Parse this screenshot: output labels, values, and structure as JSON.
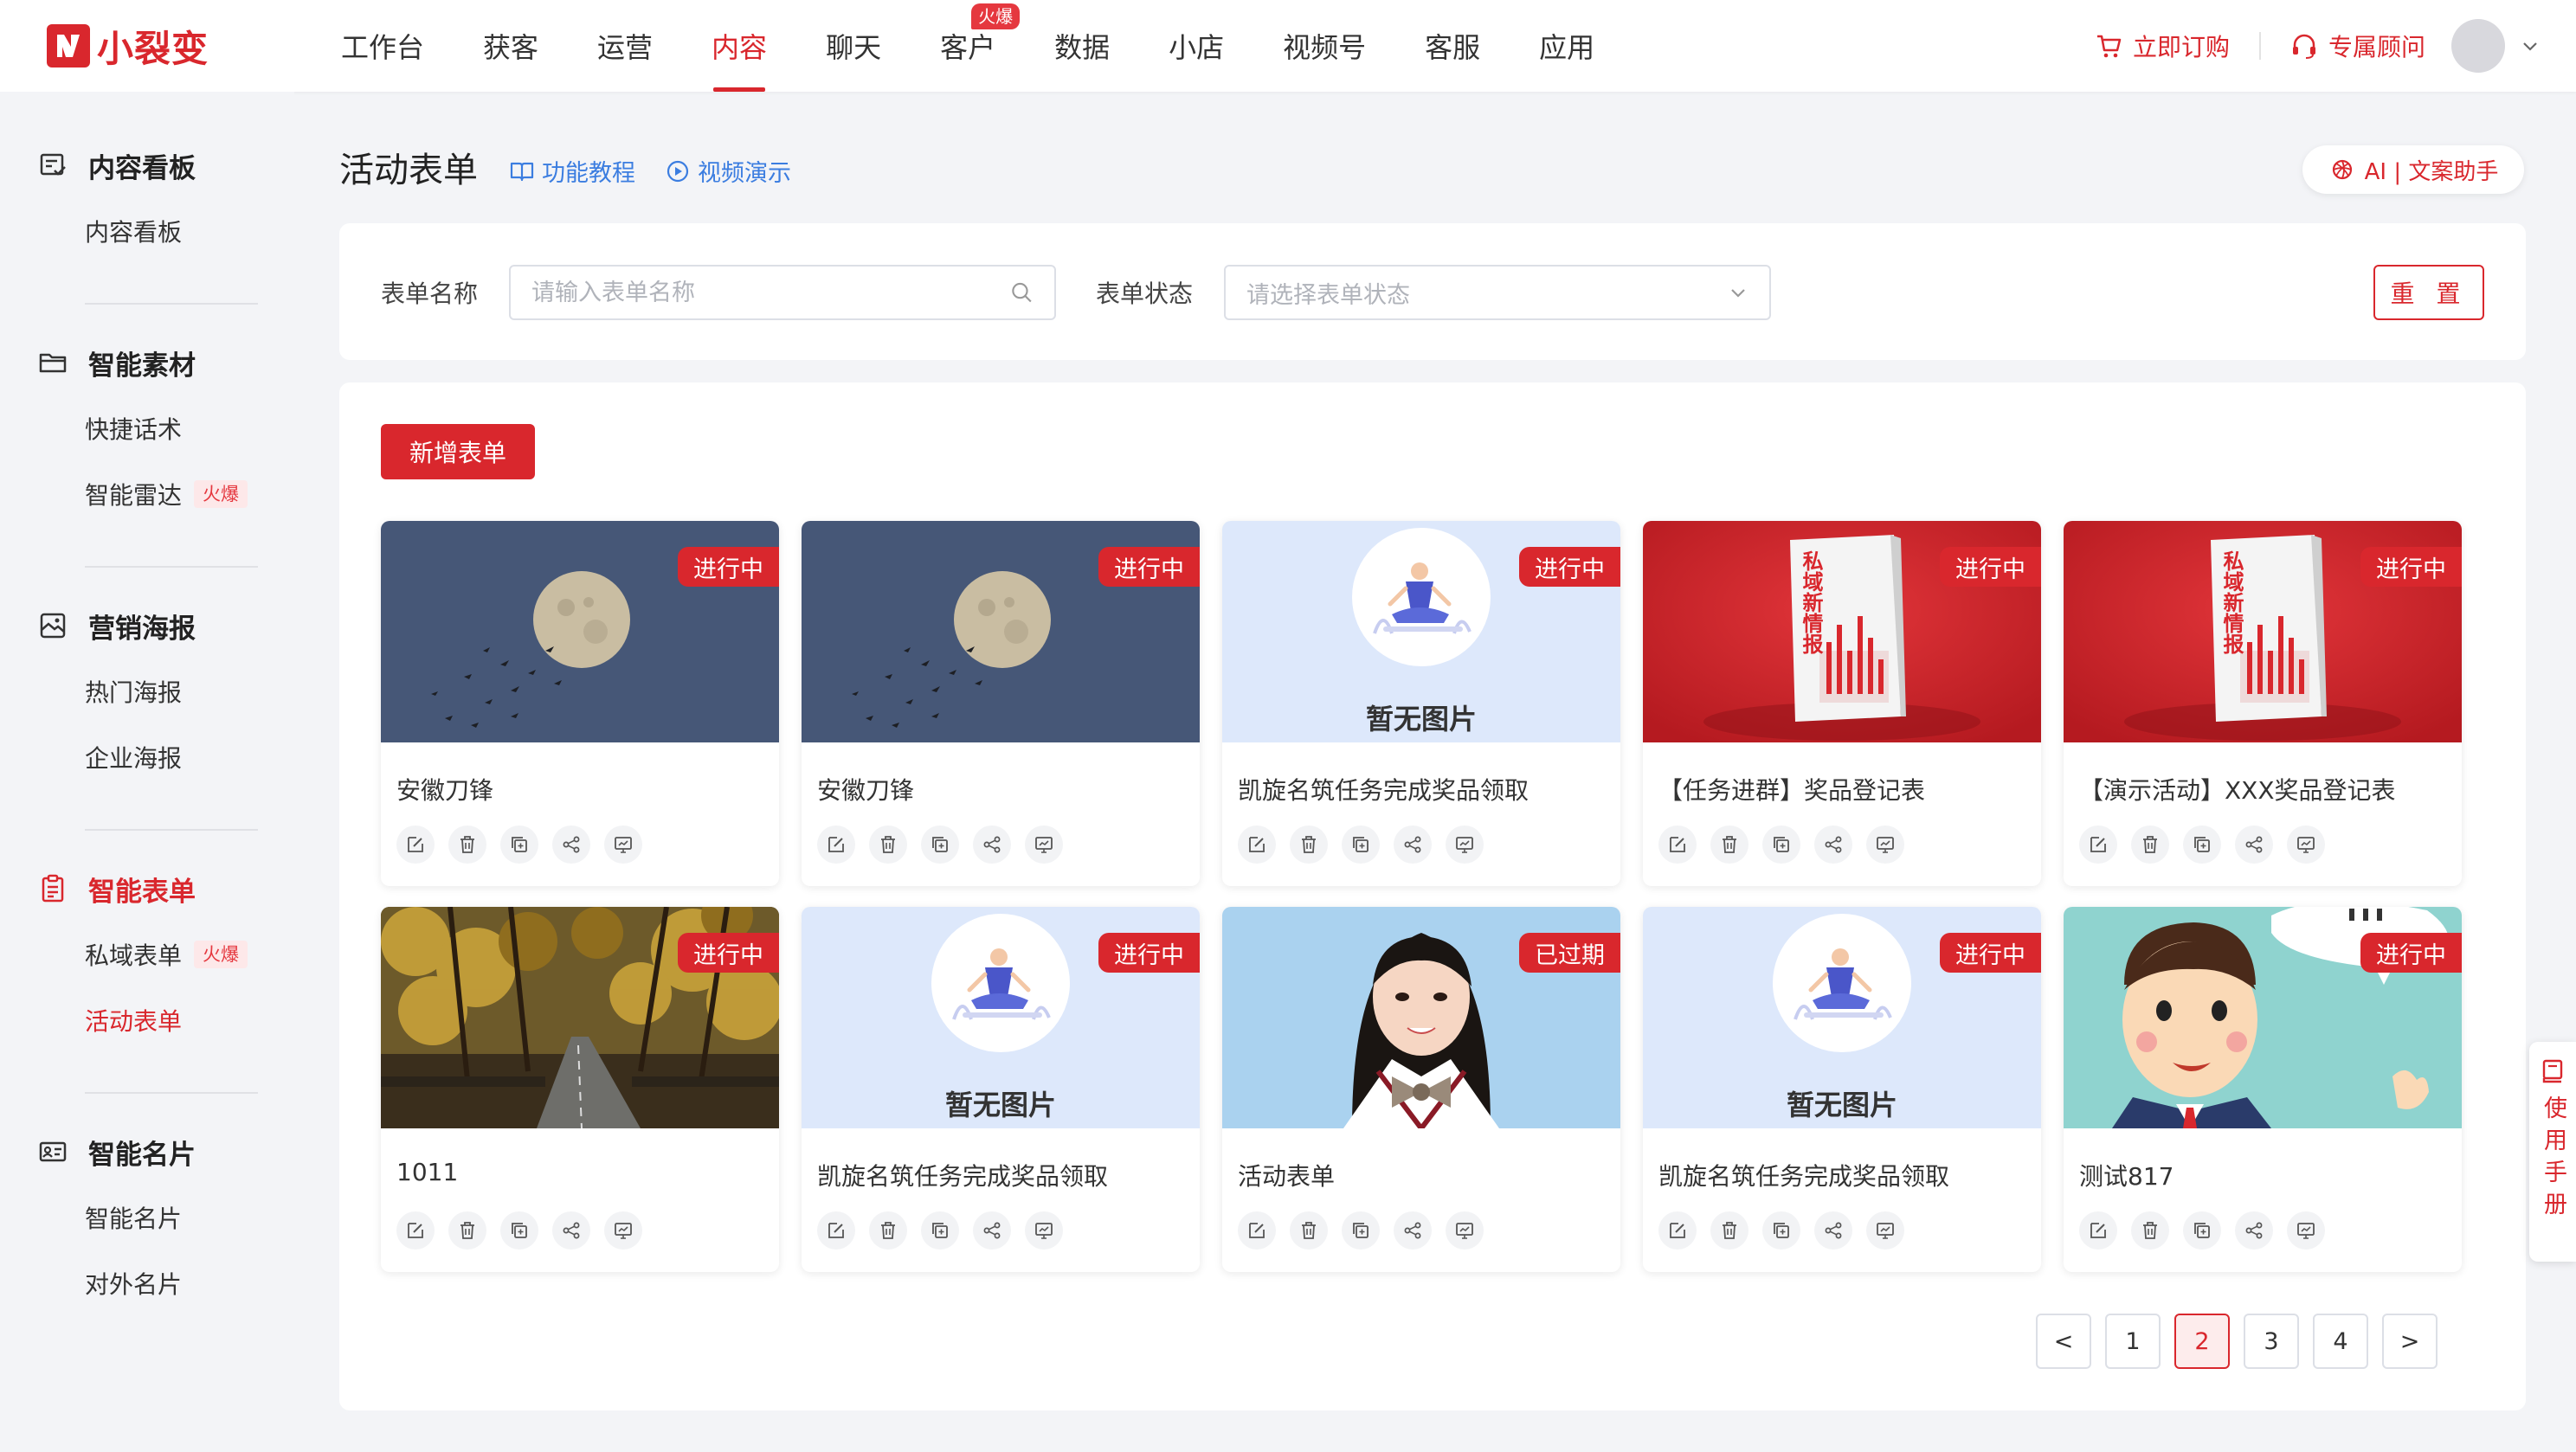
{
  "brand": {
    "name": "小裂变",
    "color": "#d9272d"
  },
  "nav": {
    "items": [
      {
        "label": "工作台"
      },
      {
        "label": "获客"
      },
      {
        "label": "运营"
      },
      {
        "label": "内容",
        "active": true
      },
      {
        "label": "聊天"
      },
      {
        "label": "客户",
        "badge": "火爆"
      },
      {
        "label": "数据"
      },
      {
        "label": "小店"
      },
      {
        "label": "视频号"
      },
      {
        "label": "客服"
      },
      {
        "label": "应用"
      }
    ],
    "order_label": "立即订购",
    "advisor_label": "专属顾问"
  },
  "sidebar": {
    "groups": [
      {
        "title": "内容看板",
        "icon": "dashboard-icon",
        "items": [
          {
            "label": "内容看板"
          }
        ]
      },
      {
        "title": "智能素材",
        "icon": "folder-icon",
        "items": [
          {
            "label": "快捷话术"
          },
          {
            "label": "智能雷达",
            "badge": "火爆"
          }
        ]
      },
      {
        "title": "营销海报",
        "icon": "poster-icon",
        "items": [
          {
            "label": "热门海报"
          },
          {
            "label": "企业海报"
          }
        ]
      },
      {
        "title": "智能表单",
        "icon": "form-icon",
        "active": true,
        "items": [
          {
            "label": "私域表单",
            "badge": "火爆"
          },
          {
            "label": "活动表单",
            "active": true
          }
        ]
      },
      {
        "title": "智能名片",
        "icon": "card-icon",
        "items": [
          {
            "label": "智能名片"
          },
          {
            "label": "对外名片"
          }
        ]
      }
    ]
  },
  "page": {
    "title": "活动表单",
    "tutorial_label": "功能教程",
    "video_label": "视频演示",
    "ai_label": "AI | 文案助手"
  },
  "filters": {
    "name_label": "表单名称",
    "name_placeholder": "请输入表单名称",
    "status_label": "表单状态",
    "status_placeholder": "请选择表单状态",
    "reset_label": "重 置"
  },
  "list": {
    "add_label": "新增表单",
    "no_image_text": "暂无图片",
    "cards": [
      {
        "title": "安徽刀锋",
        "status": "进行中",
        "image": "moon"
      },
      {
        "title": "安徽刀锋",
        "status": "进行中",
        "image": "moon"
      },
      {
        "title": "凯旋名筑任务完成奖品领取",
        "status": "进行中",
        "image": "none"
      },
      {
        "title": "【任务进群】奖品登记表",
        "status": "进行中",
        "image": "book"
      },
      {
        "title": "【演示活动】XXX奖品登记表",
        "status": "进行中",
        "image": "book"
      },
      {
        "title": "1011",
        "status": "进行中",
        "image": "forest"
      },
      {
        "title": "凯旋名筑任务完成奖品领取",
        "status": "进行中",
        "image": "none"
      },
      {
        "title": "活动表单",
        "status": "已过期",
        "image": "girl"
      },
      {
        "title": "凯旋名筑任务完成奖品领取",
        "status": "进行中",
        "image": "none"
      },
      {
        "title": "测试817",
        "status": "进行中",
        "image": "cartoon"
      }
    ]
  },
  "pagination": {
    "prev": "<",
    "next": ">",
    "pages": [
      "1",
      "2",
      "3",
      "4"
    ],
    "current": "2"
  },
  "manual": {
    "label": "使用手册"
  },
  "book_text": "私域新情报"
}
